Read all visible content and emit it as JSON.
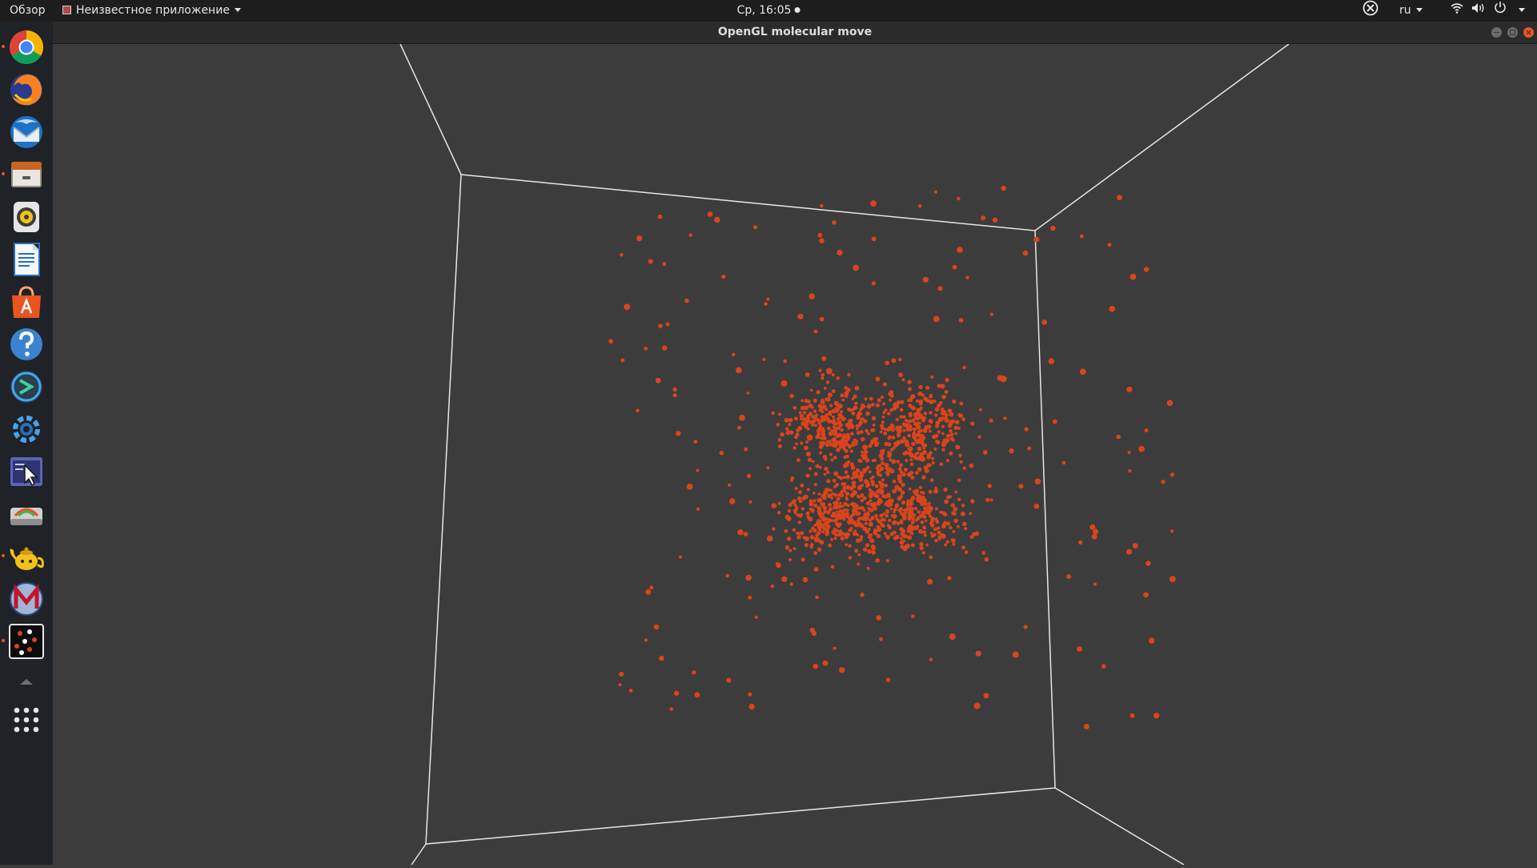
{
  "topbar": {
    "overview": "Обзор",
    "app_menu": "Неизвестное приложение",
    "clock": "Ср, 16:05",
    "language": "ru"
  },
  "window": {
    "title": "OpenGL molecular move"
  },
  "colors": {
    "accent": "#e95420",
    "particle": "#d9441c",
    "box_edges": "#e6e6e6",
    "background": "#3c3c3c"
  },
  "dock": {
    "items": [
      {
        "name": "chrome-icon",
        "running": true
      },
      {
        "name": "firefox-icon",
        "running": false
      },
      {
        "name": "thunderbird-icon",
        "running": false
      },
      {
        "name": "files-icon",
        "running": true
      },
      {
        "name": "rhythmbox-icon",
        "running": false
      },
      {
        "name": "libreoffice-writer-icon",
        "running": false
      },
      {
        "name": "software-center-icon",
        "running": false
      },
      {
        "name": "help-icon",
        "running": false
      },
      {
        "name": "remote-desktop-icon",
        "running": false
      },
      {
        "name": "settings-icon",
        "running": false
      },
      {
        "name": "screenshot-tool-icon",
        "running": false
      },
      {
        "name": "disk-usage-icon",
        "running": false
      },
      {
        "name": "teapot-icon",
        "running": true
      },
      {
        "name": "maxima-icon",
        "running": false
      },
      {
        "name": "molecular-app-icon",
        "running": true
      }
    ]
  }
}
